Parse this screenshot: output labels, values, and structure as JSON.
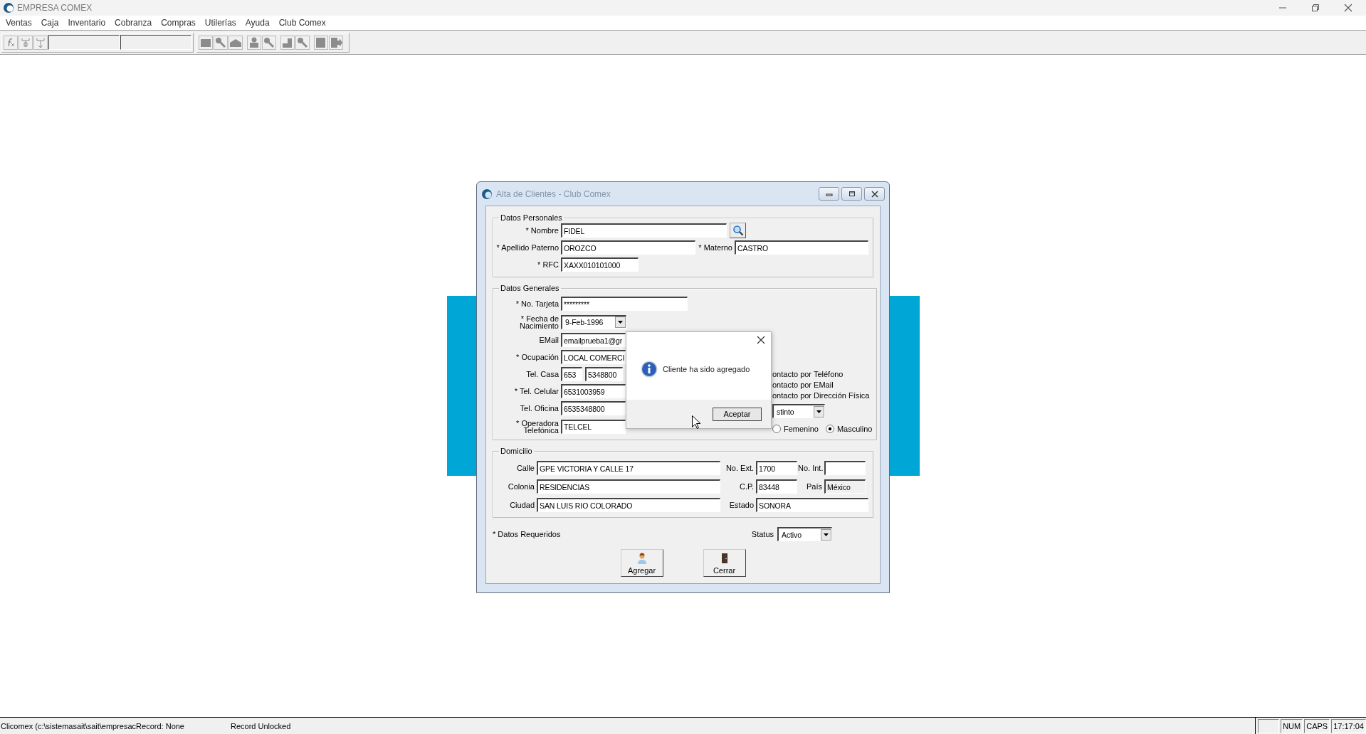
{
  "window": {
    "title": "EMPRESA COMEX"
  },
  "menu": [
    "Ventas",
    "Caja",
    "Inventario",
    "Cobranza",
    "Compras",
    "Utilerías",
    "Ayuda",
    "Club Comex"
  ],
  "dialog": {
    "title": "Alta de Clientes - Club Comex",
    "personal": {
      "legend": "Datos Personales",
      "fields": [
        {
          "label": "* Nombre",
          "value": "FIDEL"
        },
        {
          "label": "* Apellido Paterno",
          "value": "OROZCO"
        },
        {
          "label": "* Materno",
          "value": "CASTRO"
        },
        {
          "label": "* RFC",
          "value": "XAXX010101000"
        }
      ]
    },
    "general": {
      "legend": "Datos Generales",
      "fields": [
        {
          "label": "* No. Tarjeta",
          "value": "*********"
        },
        {
          "label": "* Fecha de Nacimiento",
          "value": "9-Feb-1996"
        },
        {
          "label": "EMail",
          "value": "emailprueba1@gr"
        },
        {
          "label": "* Ocupación",
          "value": "LOCAL COMERCI"
        },
        {
          "label": "Tel. Casa",
          "value": "653",
          "value_2": "5348800"
        },
        {
          "label": "* Tel. Celular",
          "value": "6531003959"
        },
        {
          "label": "Tel. Oficina",
          "value": "6535348800"
        },
        {
          "label": "* Operadora Telefónica",
          "value": "TELCEL"
        }
      ],
      "contact_options": [
        "ontacto por Teléfono",
        "ontacto por EMail",
        "ontacto por Dirección Física"
      ],
      "dropdown_value": "stinto",
      "sex_options": [
        {
          "label": "Femenino",
          "selected": false
        },
        {
          "label": "Masculino",
          "selected": true
        }
      ]
    },
    "address": {
      "legend": "Domicilio",
      "fields": [
        {
          "label": "Calle",
          "value": "GPE VICTORIA Y CALLE 17",
          "disabled": false
        },
        {
          "label": "No. Ext.",
          "value": "1700",
          "disabled": false
        },
        {
          "label": "No. Int.",
          "disabled": false
        },
        {
          "label": "Colonia",
          "value": "RESIDENCIAS",
          "disabled": false
        },
        {
          "label": "C.P.",
          "value": "83448",
          "disabled": false
        },
        {
          "label": "País",
          "value": "México",
          "disabled": true
        },
        {
          "label": "Ciudad",
          "value": "SAN LUIS RIO COLORADO",
          "disabled": false
        },
        {
          "label": "Estado",
          "value": "SONORA",
          "disabled": false
        }
      ]
    },
    "required_note": "* Datos Requeridos",
    "status": {
      "label": "Status",
      "value": "Activo"
    },
    "buttons": [
      {
        "kind": "add",
        "label": "Agregar"
      },
      {
        "kind": "close",
        "label": "Cerrar"
      }
    ]
  },
  "message_box": {
    "text": "Cliente ha sido agregado",
    "button": "Aceptar"
  },
  "status_bar": {
    "panes": [
      "Clicomex (c:\\sistemasait\\sait\\empresac",
      "Record: None",
      "Record Unlocked"
    ],
    "indicators": [
      "NUM",
      "CAPS",
      "17:17:04"
    ]
  }
}
